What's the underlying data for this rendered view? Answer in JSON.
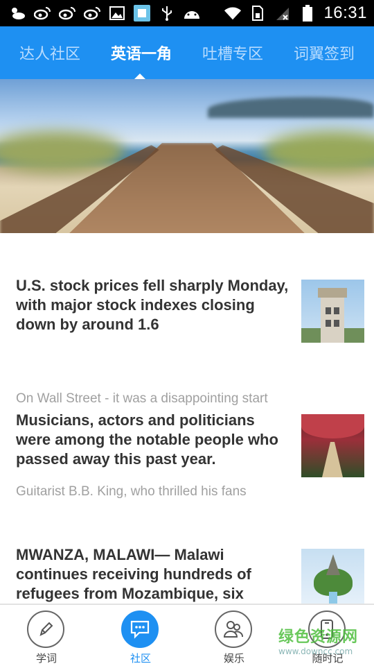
{
  "status_bar": {
    "time": "16:31",
    "left_icons": [
      "weather-icon",
      "weibo-icon",
      "weibo-icon",
      "weibo-icon",
      "image-icon",
      "app-icon",
      "usb-icon",
      "android-icon"
    ],
    "right_icons": [
      "wifi-icon",
      "sim-icon",
      "signal-icon",
      "battery-icon"
    ]
  },
  "tabs": [
    {
      "label": "达人社区",
      "active": false
    },
    {
      "label": "英语一角",
      "active": true
    },
    {
      "label": "吐槽专区",
      "active": false
    },
    {
      "label": "词翼签到",
      "active": false
    }
  ],
  "articles": [
    {
      "title": "U.S. stock prices fell sharply Monday, with major stock indexes closing down by around 1.6",
      "summary": "On Wall Street - it was a disappointing start",
      "thumb": "tower-photo"
    },
    {
      "title": "Musicians, actors and politicians were among the notable people who passed away this past year.",
      "summary": "Guitarist B.B. King, who thrilled his fans",
      "thumb": "garden-photo"
    },
    {
      "title": "MWANZA, MALAWI— Malawi continues receiving hundreds of refugees from Mozambique, six",
      "summary": "",
      "thumb": "island-photo"
    }
  ],
  "bottom_nav": [
    {
      "label": "学词",
      "icon": "pen-icon",
      "active": false
    },
    {
      "label": "社区",
      "icon": "chat-icon",
      "active": true
    },
    {
      "label": "娱乐",
      "icon": "people-icon",
      "active": false
    },
    {
      "label": "随时记",
      "icon": "phone-icon",
      "active": false
    }
  ],
  "watermark": {
    "main": "绿色资源网",
    "sub": "www.downcc.com"
  },
  "colors": {
    "accent": "#1e90f2",
    "title_text": "#333333",
    "summary_text": "#a0a0a0"
  }
}
